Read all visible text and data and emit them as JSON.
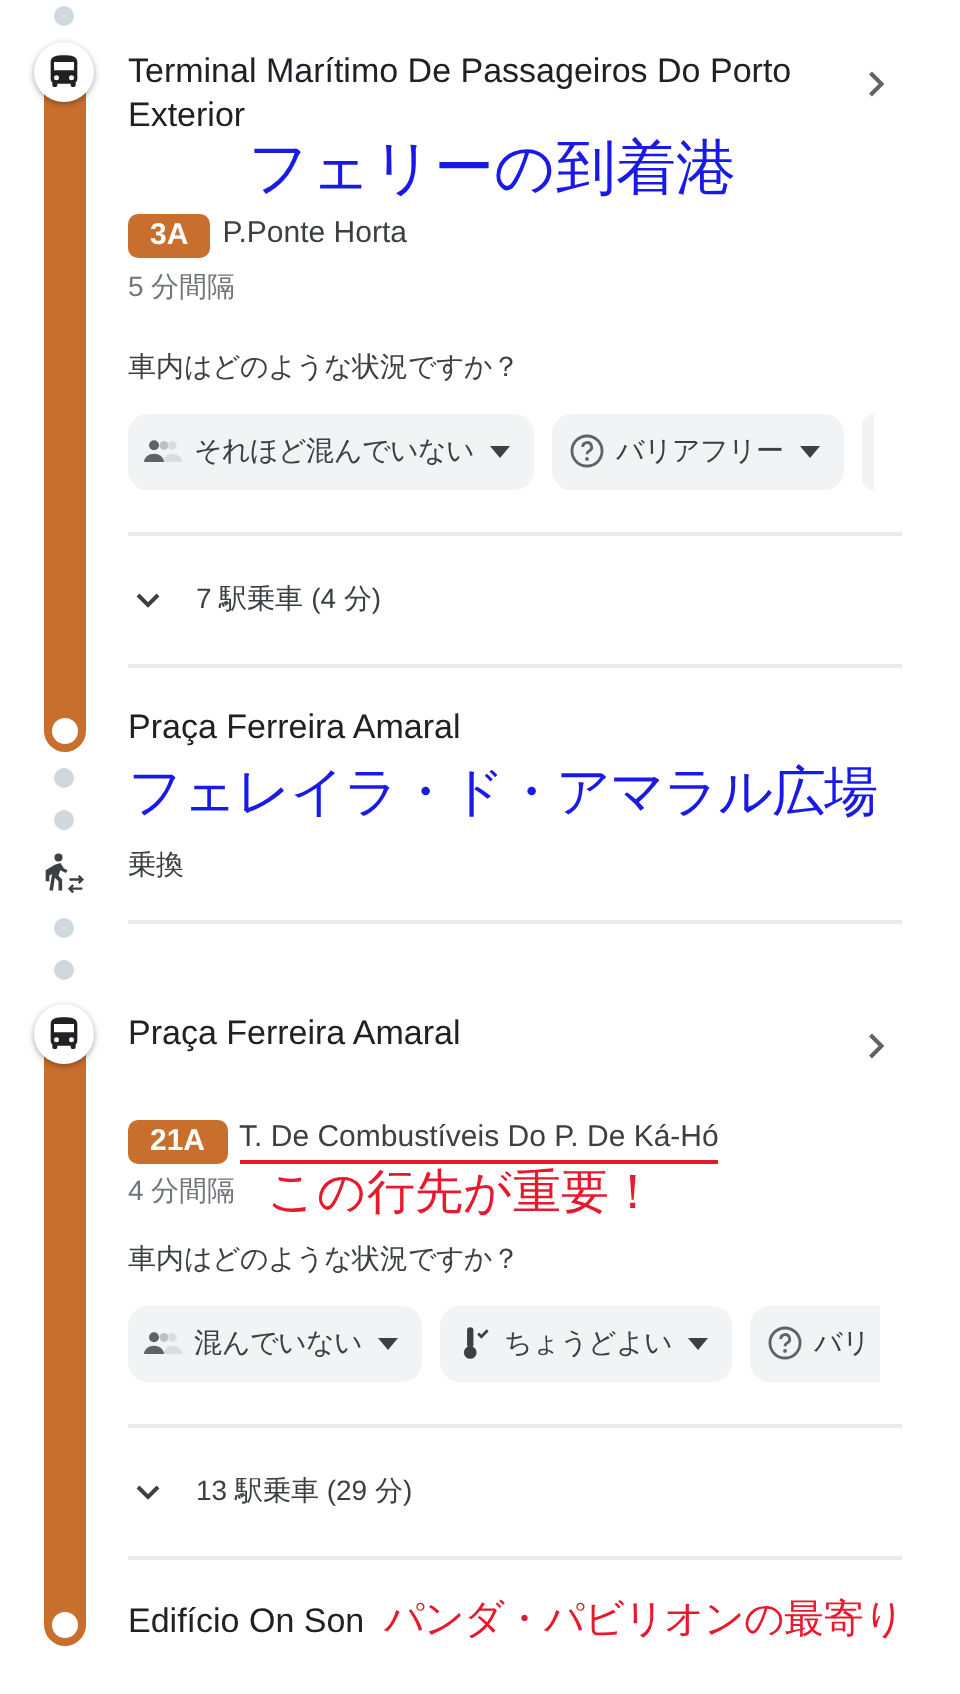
{
  "steps": [
    {
      "kind": "leg",
      "stop": "Terminal Marítimo De Passageiros Do Porto Exterior",
      "stop_note": {
        "text": "フェリーの到着港",
        "color": "#1a1ae6"
      },
      "route": "3A",
      "color": "#c96f2e",
      "headsign": "P.Ponte Horta",
      "headsign_marked": false,
      "frequency": "5 分間隔",
      "question": "車内はどのような状況ですか？",
      "chips": [
        {
          "kind": "crowd",
          "label": "それほど混んでいない",
          "dropdown": true
        },
        {
          "kind": "access",
          "label": "バリアフリー",
          "dropdown": true
        },
        {
          "kind": "more"
        }
      ],
      "rides": "7 駅乗車 (4 分)",
      "alight": "Praça Ferreira Amaral"
    },
    {
      "kind": "transfer",
      "note": {
        "text": "フェレイラ・ド・アマラル広場",
        "color": "#1a1ae6"
      },
      "label": "乗換"
    },
    {
      "kind": "leg",
      "stop": "Praça Ferreira Amaral",
      "route": "21A",
      "color": "#c96f2e",
      "headsign": "T. De Combustíveis Do P. De Ká-Hó",
      "headsign_marked": true,
      "frequency": "4 分間隔",
      "frequency_note": {
        "text": "この行先が重要！",
        "color": "#e8192c"
      },
      "question": "車内はどのような状況ですか？",
      "chips": [
        {
          "kind": "crowd",
          "label": "混んでいない",
          "dropdown": true
        },
        {
          "kind": "comfort",
          "label": "ちょうどよい",
          "dropdown": true
        },
        {
          "kind": "access",
          "label": "バリ",
          "dropdown": false
        }
      ],
      "rides": "13 駅乗車 (29 分)",
      "alight": "Edifício On Son",
      "alight_note": {
        "text": "パンダ・パビリオンの最寄り",
        "color": "#e8192c"
      }
    }
  ]
}
